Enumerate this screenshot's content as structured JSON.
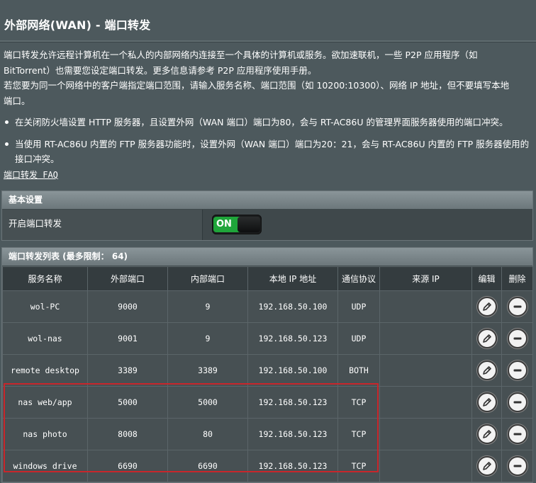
{
  "page": {
    "title": "外部网络(WAN) - 端口转发",
    "desc_line1": "端口转发允许远程计算机在一个私人的内部网络内连接至一个具体的计算机或服务。欲加速联机，一些 P2P 应用程序（如",
    "desc_line2": "BitTorrent）也需要您设定端口转发。更多信息请参考 P2P 应用程序使用手册。",
    "desc_line3": "若您要为同一个网络中的客户端指定端口范围，请输入服务名称、端口范围（如 10200:10300）、网络 IP 地址，但不要填写本地",
    "desc_line4": "端口。",
    "bullet1": "在关闭防火墙设置 HTTP 服务器，且设置外网（WAN 端口）端口为80，会与 RT-AC86U 的管理界面服务器使用的端口冲突。",
    "bullet2": "当使用 RT-AC86U 内置的 FTP 服务器功能时，设置外网（WAN 端口）端口为20：21，会与 RT-AC86U 内置的 FTP 服务器使用的接口冲突。",
    "faq_link": "端口转发 FAQ"
  },
  "basic": {
    "section_title": "基本设置",
    "enable_label": "开启端口转发",
    "toggle_text": "ON"
  },
  "list": {
    "section_title": "端口转发列表 (最多限制： 64)",
    "columns": {
      "service": "服务名称",
      "ext_port": "外部端口",
      "int_port": "内部端口",
      "local_ip": "本地 IP 地址",
      "protocol": "通信协议",
      "source_ip": "来源 IP",
      "edit": "编辑",
      "delete": "删除"
    },
    "rows": [
      {
        "service": "wol-PC",
        "ext_port": "9000",
        "int_port": "9",
        "local_ip": "192.168.50.100",
        "protocol": "UDP",
        "source_ip": ""
      },
      {
        "service": "wol-nas",
        "ext_port": "9001",
        "int_port": "9",
        "local_ip": "192.168.50.123",
        "protocol": "UDP",
        "source_ip": ""
      },
      {
        "service": "remote desktop",
        "ext_port": "3389",
        "int_port": "3389",
        "local_ip": "192.168.50.100",
        "protocol": "BOTH",
        "source_ip": ""
      },
      {
        "service": "nas web/app",
        "ext_port": "5000",
        "int_port": "5000",
        "local_ip": "192.168.50.123",
        "protocol": "TCP",
        "source_ip": ""
      },
      {
        "service": "nas photo",
        "ext_port": "8008",
        "int_port": "80",
        "local_ip": "192.168.50.123",
        "protocol": "TCP",
        "source_ip": ""
      },
      {
        "service": "windows drive",
        "ext_port": "6690",
        "int_port": "6690",
        "local_ip": "192.168.50.123",
        "protocol": "TCP",
        "source_ip": ""
      }
    ]
  },
  "colors": {
    "background": "#4d595d",
    "toggle_on": "#1fa53a",
    "highlight": "#c8262b"
  }
}
